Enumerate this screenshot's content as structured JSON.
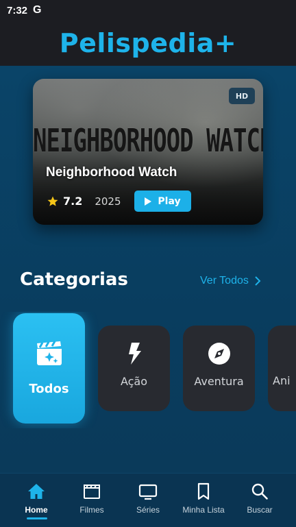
{
  "status_bar": {
    "time": "7:32",
    "indicator": "G"
  },
  "app": {
    "title": "Pelispedia+",
    "accent_color": "#1eb3ea"
  },
  "featured": {
    "poster_title": "NEIGHBORHOOD WATCH",
    "badge": "HD",
    "title": "Neighborhood Watch",
    "rating": "7.2",
    "year": "2025",
    "play_label": "Play",
    "icons": {
      "rating": "star-icon",
      "play": "play-icon"
    }
  },
  "categories": {
    "title": "Categorias",
    "see_all": "Ver Todos",
    "items": [
      {
        "label": "Todos",
        "icon": "clapperboard-sparkle-icon",
        "active": true
      },
      {
        "label": "Ação",
        "icon": "lightning-icon",
        "active": false
      },
      {
        "label": "Aventura",
        "icon": "compass-icon",
        "active": false
      },
      {
        "label": "Ani",
        "icon": "",
        "active": false
      }
    ]
  },
  "bottom_nav": {
    "items": [
      {
        "label": "Home",
        "icon": "home-icon",
        "active": true
      },
      {
        "label": "Filmes",
        "icon": "film-icon",
        "active": false
      },
      {
        "label": "Séries",
        "icon": "tv-icon",
        "active": false
      },
      {
        "label": "Minha Lista",
        "icon": "bookmark-icon",
        "active": false
      },
      {
        "label": "Buscar",
        "icon": "search-icon",
        "active": false
      }
    ]
  }
}
